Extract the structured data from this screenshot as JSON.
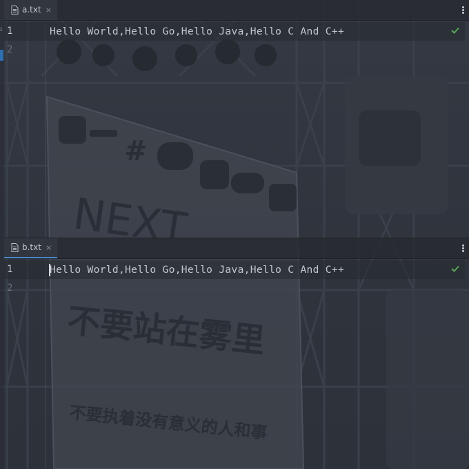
{
  "editors": [
    {
      "tab": {
        "label": "a.txt",
        "close": "×",
        "active": false
      },
      "lines": [
        {
          "number": "1",
          "text": "Hello World,Hello Go,Hello Java,Hello C And C++"
        },
        {
          "number": "2",
          "text": ""
        }
      ],
      "status_icon": "checkmark-icon"
    },
    {
      "tab": {
        "label": "b.txt",
        "close": "×",
        "active": true
      },
      "lines": [
        {
          "number": "1",
          "text": "Hello World,Hello Go,Hello Java,Hello C And C++"
        },
        {
          "number": "2",
          "text": ""
        }
      ],
      "status_icon": "checkmark-icon"
    }
  ],
  "background_image": {
    "banner_text_large": "NEXT",
    "banner_slogan_1": "不要站在雾里",
    "banner_slogan_2": "不要执着没有意义的人和事"
  },
  "colors": {
    "accent": "#4a88c7",
    "check": "#5aa75a",
    "text": "#c3c8d0"
  }
}
